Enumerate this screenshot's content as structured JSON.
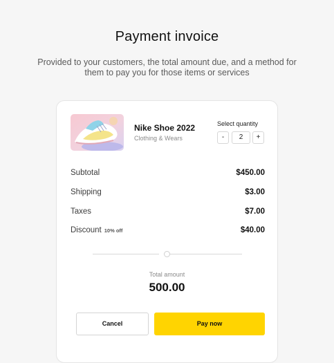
{
  "header": {
    "title": "Payment invoice",
    "subtitle": "Provided to your customers, the total amount due, and a method for them to pay you for those items or services"
  },
  "product": {
    "name": "Nike Shoe 2022",
    "category": "Clothing & Wears",
    "image_icon": "sneaker-product-image"
  },
  "quantity": {
    "label": "Select quantity",
    "minus": "-",
    "value": "2",
    "plus": "+"
  },
  "summary": [
    {
      "label": "Subtotal",
      "tag": "",
      "amount": "$450.00"
    },
    {
      "label": "Shipping",
      "tag": "",
      "amount": "$3.00"
    },
    {
      "label": "Taxes",
      "tag": "",
      "amount": "$7.00"
    },
    {
      "label": "Discount",
      "tag": "10% off",
      "amount": "$40.00"
    }
  ],
  "total": {
    "label": "Total amount",
    "value": "500.00"
  },
  "actions": {
    "cancel_label": "Cancel",
    "pay_label": "Pay now"
  },
  "colors": {
    "accent": "#ffd401",
    "background": "#f6f6f6",
    "card": "#ffffff"
  }
}
